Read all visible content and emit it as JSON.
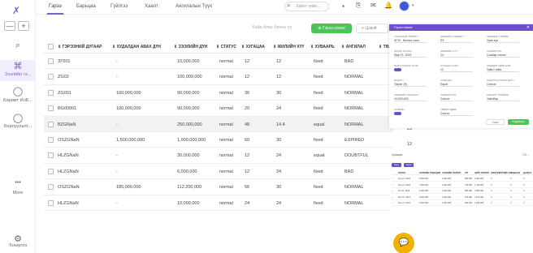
{
  "app": {
    "logo": "✗",
    "zoom_out": "—",
    "zoom_in": "+",
    "accent": "#7c5cd6"
  },
  "sidebar": {
    "items": [
      {
        "icon": "search-icon",
        "glyph": "⌕",
        "label": ""
      },
      {
        "icon": "org-chart-icon",
        "glyph": "⌘",
        "label": "Зээлийн гэ..."
      },
      {
        "icon": "chat-icon",
        "glyph": "◯",
        "label": "Баримт ИлБ..."
      },
      {
        "icon": "chat-icon",
        "glyph": "◯",
        "label": "Борлуулалт..."
      },
      {
        "icon": "more-icon",
        "glyph": "•••",
        "label": "More"
      },
      {
        "icon": "gear-icon",
        "glyph": "⚙",
        "label": "Тохиргоо"
      }
    ]
  },
  "tabs": [
    "Гэрээ",
    "Барьцаа",
    "Гүйлгээ",
    "Хаалт",
    "Ангилалын Түүх"
  ],
  "search": {
    "placeholder": "Хайлт хийх..."
  },
  "actions": {
    "hint": "Хайх блок бичнэ үү",
    "add_label": "Гэрээ нэмэх",
    "delete_label": "Цэвэй"
  },
  "table": {
    "headers": [
      "ГЭРЭЭНИЙ ДУГААР",
      "ХУДАЛДАН АВАХ ДҮН",
      "ЗЭЭЛИЙН ДҮН",
      "СТАТУС",
      "ХУГАЦАА",
      "ЖИЛИЙН ХҮҮ",
      "ХУВААРЬ",
      "АНГИЛАЛ",
      "ТӨЛ"
    ],
    "rows": [
      [
        "ЗГ001",
        "-",
        "10,000,000",
        "normal",
        "12",
        "12",
        "fixed",
        "BAD"
      ],
      [
        "ZG02",
        "-",
        "100,000,000",
        "normal",
        "12",
        "12",
        "fixed",
        "NORMAL"
      ],
      [
        "ZG001",
        "160,000,000",
        "90,000,000",
        "normal",
        "36",
        "30",
        "fixed",
        "NORMAL"
      ],
      [
        "BG00001",
        "100,000,000",
        "90,000,000",
        "normal",
        "20",
        "24",
        "fixed",
        "NORMAL"
      ],
      [
        "BZGNaN",
        "-",
        "250,000,000",
        "normal",
        "48",
        "14.4",
        "equal",
        "NORMAL"
      ],
      [
        "OSZGNaN",
        "1,500,000,000",
        "1,000,000,000",
        "normal",
        "60",
        "30",
        "fixed",
        "EXPIRED"
      ],
      [
        "HLZGNaN",
        "-",
        "30,000,000",
        "normal",
        "12",
        "24",
        "equal",
        "DOUBTFUL"
      ],
      [
        "HLZGNaN",
        "-",
        "6,000,000",
        "normal",
        "12",
        "24",
        "fixed",
        "BAD"
      ],
      [
        "OSZGNaN",
        "185,000,000",
        "112,200,000",
        "normal",
        "56",
        "30",
        "fixed",
        "NORMAL"
      ],
      [
        "HLZGNaN",
        "-",
        "10,000,000",
        "normal",
        "24",
        "24",
        "fixed",
        "NORMAL"
      ]
    ],
    "overflow_values": [
      "25",
      "12"
    ]
  },
  "modal": {
    "title": "Гэрээ нэмэх",
    "fields": [
      {
        "label": "Гэрээний төрөл *",
        "value": "ЗГ00 - Бизнес зээл"
      },
      {
        "label": "Зээлийн хэлбэр *",
        "value": "ЕЗ"
      },
      {
        "label": "Зээлдэгч төрөл",
        "value": "Хувь хүн"
      },
      {
        "label": "Эхлэх огноо",
        "value": "May 07, 2023"
      },
      {
        "label": "Зээлийн хүү *",
        "value": "24"
      },
      {
        "label": "Салбарууд",
        "value": "Салбар сонгох"
      },
      {
        "label": "Байгууллага эсэх",
        "value": ""
      },
      {
        "label": "Хугацаа /сар/",
        "value": "12"
      },
      {
        "label": "Зээлдэгчийн нэр",
        "value": "Хайлт хийх"
      },
      {
        "label": "Валют *",
        "value": "Төгрөг (₮)"
      },
      {
        "label": "Хуваарь",
        "value": "Equal"
      },
      {
        "label": "Ажилтан хариуцагч",
        "value": "Сонгох"
      },
      {
        "label": "Зээлийн хэмжээ *",
        "value": "10,000,000"
      },
      {
        "label": "Холбоотой",
        "value": "Сонгох"
      },
      {
        "label": "Нэмэлт тайлбар",
        "value": "Тайлбар"
      },
      {
        "label": "Хувийн",
        "value": ""
      },
      {
        "label": "Төлөх өдөр",
        "value": "Сонгох"
      }
    ],
    "cancel_label": "Хаах",
    "save_label": "Хадгалах",
    "header_color": "#6b4fcf"
  },
  "schedule": {
    "title": "Хуваарь",
    "pager": "1/5 ⌄",
    "buttons": [
      "Бүгд",
      "Төлөх"
    ],
    "headers": [
      "ОГНОО",
      "ЗЭЭЛИЙН ҮЛДЭГДЭЛ",
      "ЗЭЭЛИЙН ТӨЛӨЛТ",
      "ХҮҮ",
      "НИЙТ ТӨЛӨЛТ",
      "ХӨНГӨЛӨЛТИЙН ХҮҮ",
      "АЛДАНГИ",
      "ДАЛЛАГ"
    ],
    "rows": [
      [
        "Aug 21, 2023",
        "8,000,000",
        "1,000,000",
        "900,000",
        "1,900,000",
        "0",
        "0",
        "0"
      ],
      [
        "Sep 21, 2023",
        "7,000,000",
        "1,000,000",
        "790,000",
        "1,790,000",
        "0",
        "0",
        "0"
      ],
      [
        "Oct 21, 2023",
        "6,000,000",
        "1,000,000",
        "680,000",
        "1,680,000",
        "0",
        "0",
        "0"
      ],
      [
        "Nov 21, 2023",
        "5,000,000",
        "1,000,000",
        "570,000",
        "1,570,000",
        "0",
        "0",
        "0"
      ],
      [
        "Dec 21, 2023",
        "4,000,000",
        "1,000,000",
        "460,000",
        "1,460,000",
        "0",
        "0",
        "0"
      ]
    ]
  }
}
